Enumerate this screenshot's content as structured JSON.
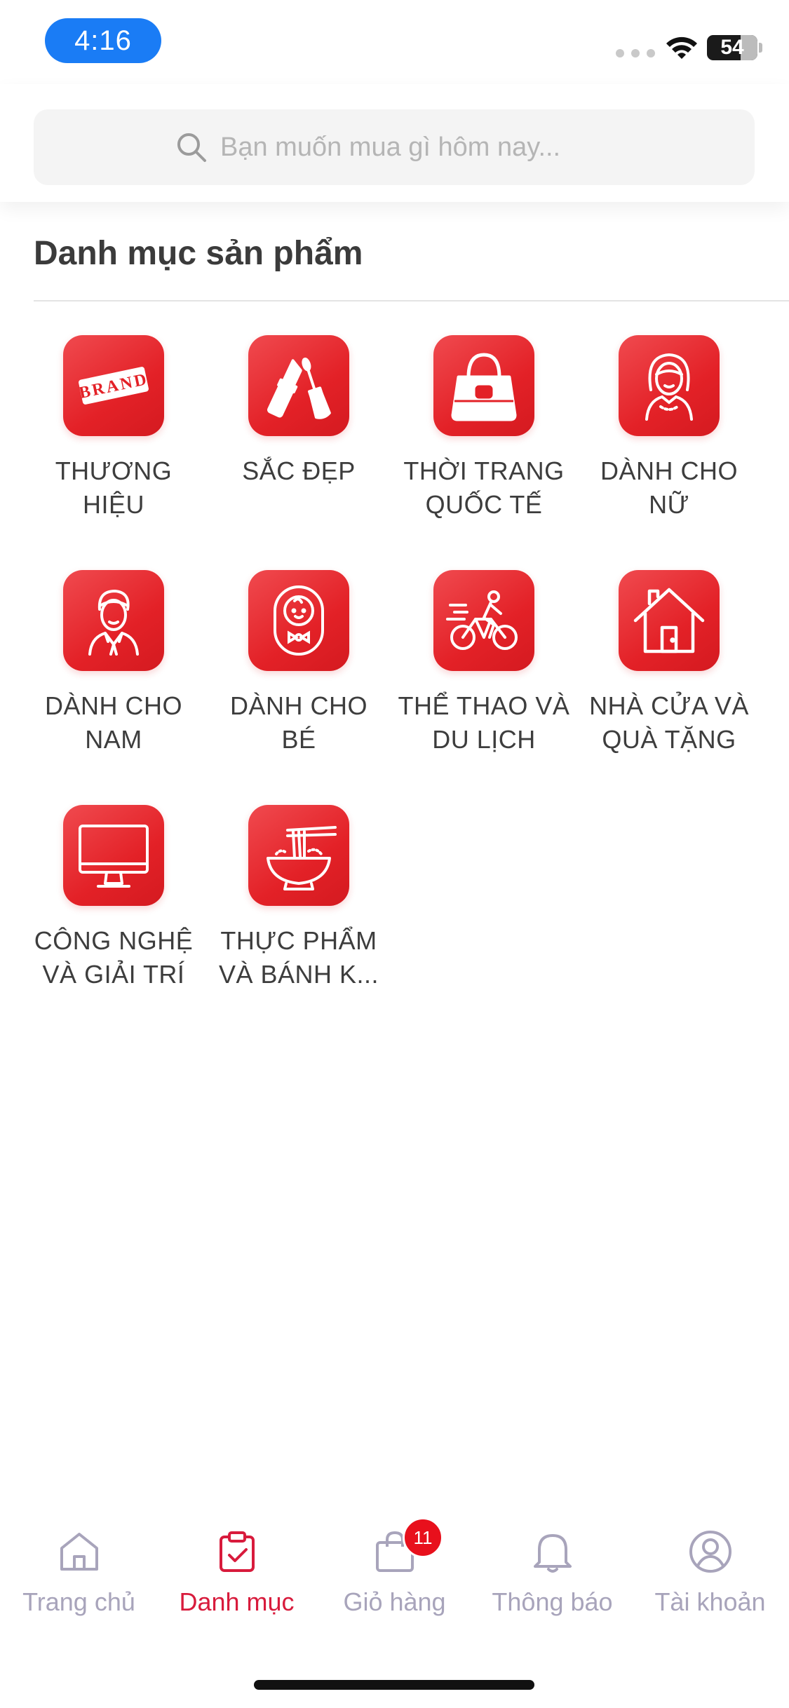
{
  "status_bar": {
    "time": "4:16",
    "battery": "54"
  },
  "search": {
    "placeholder": "Bạn muốn mua gì hôm nay..."
  },
  "section": {
    "title": "Danh mục sản phẩm"
  },
  "categories": [
    {
      "label": "THƯƠNG HIỆU",
      "icon": "brand-stamp-icon"
    },
    {
      "label": "SẮC ĐẸP",
      "icon": "lipstick-icon"
    },
    {
      "label": "THỜI TRANG QUỐC TẾ",
      "icon": "handbag-icon"
    },
    {
      "label": "DÀNH CHO NỮ",
      "icon": "woman-icon"
    },
    {
      "label": "DÀNH CHO NAM",
      "icon": "man-icon"
    },
    {
      "label": "DÀNH CHO BÉ",
      "icon": "baby-icon"
    },
    {
      "label": "THỂ THAO VÀ DU LỊCH",
      "icon": "cyclist-icon"
    },
    {
      "label": "NHÀ CỬA VÀ QUÀ TẶNG",
      "icon": "house-icon"
    },
    {
      "label": "CÔNG NGHỆ VÀ GIẢI TRÍ",
      "icon": "monitor-icon"
    },
    {
      "label": "THỰC PHẨM VÀ BÁNH K...",
      "icon": "noodle-bowl-icon"
    }
  ],
  "brand_icon_text": "BRAND",
  "bottom_nav": {
    "items": [
      {
        "label": "Trang chủ",
        "icon": "home-icon",
        "active": false
      },
      {
        "label": "Danh mục",
        "icon": "clipboard-check-icon",
        "active": true
      },
      {
        "label": "Giỏ hàng",
        "icon": "shopping-bag-icon",
        "active": false,
        "badge": "11"
      },
      {
        "label": "Thông báo",
        "icon": "bell-icon",
        "active": false
      },
      {
        "label": "Tài khoản",
        "icon": "account-icon",
        "active": false
      }
    ]
  },
  "colors": {
    "accent": "#e32127",
    "active_nav": "#d81b3c",
    "inactive_nav": "#a8a4bb",
    "time_pill": "#1a7cf5"
  }
}
